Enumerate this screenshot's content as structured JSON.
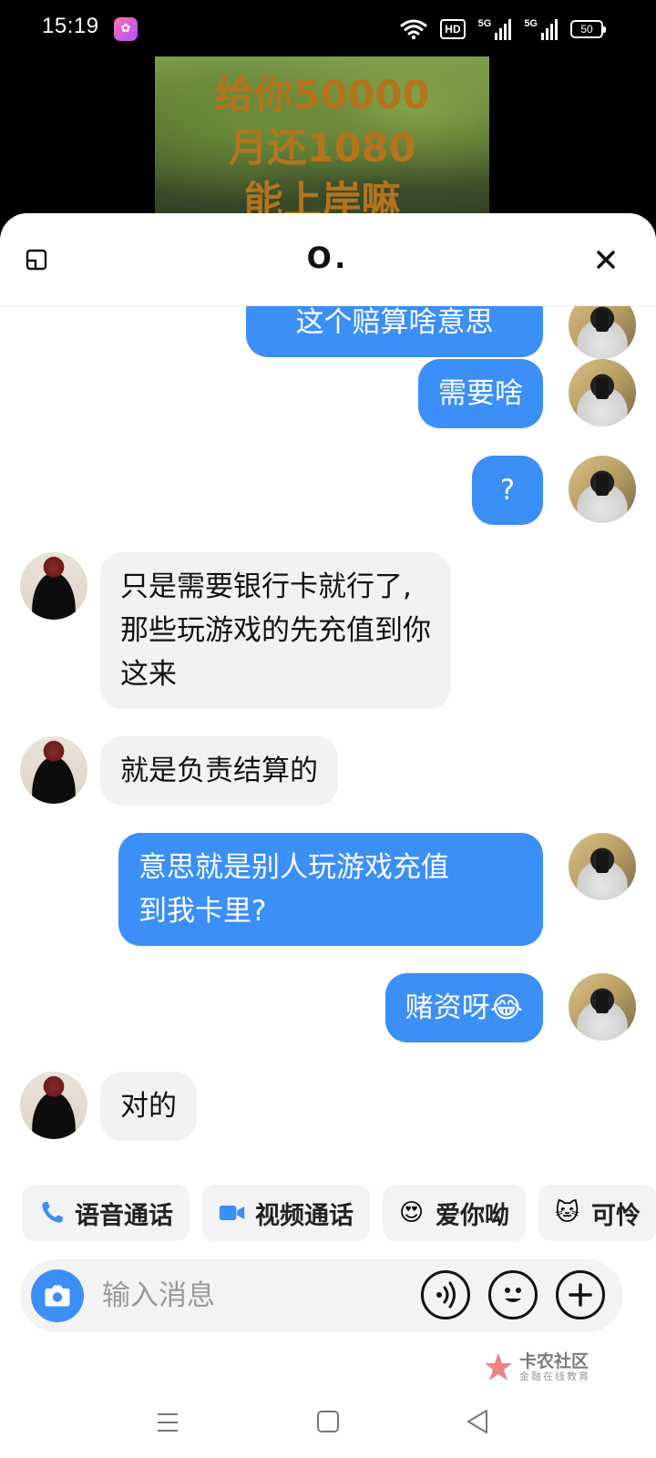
{
  "status_bar": {
    "time": "15:19",
    "hd_label": "HD",
    "signal1_label": "5G",
    "signal2_label": "5G",
    "battery": "50"
  },
  "background_media": {
    "caption_lines": [
      "给你50000",
      "月还1080",
      "能上岸嘛"
    ]
  },
  "chat_header": {
    "title": "O."
  },
  "messages": [
    {
      "sender": "self",
      "text": "这个赔算啥意思"
    },
    {
      "sender": "self",
      "text": "需要啥"
    },
    {
      "sender": "self",
      "text": "?"
    },
    {
      "sender": "other",
      "text": "只是需要银行卡就行了,\n那些玩游戏的先充值到你\n这来"
    },
    {
      "sender": "other",
      "text": "就是负责结算的"
    },
    {
      "sender": "self",
      "text": "意思就是别人玩游戏充值\n到我卡里?"
    },
    {
      "sender": "self",
      "text": "赌资呀😂"
    },
    {
      "sender": "other",
      "text": "对的"
    }
  ],
  "quick_actions": [
    {
      "label": "语音通话",
      "icon": "phone-icon"
    },
    {
      "label": "视频通话",
      "icon": "video-camera-icon"
    },
    {
      "label": "爱你呦",
      "icon": "heart-eyes-emoji-icon",
      "emoji": "😍"
    },
    {
      "label": "可怜",
      "icon": "pleading-cat-emoji-icon",
      "emoji": "🐱"
    }
  ],
  "input_bar": {
    "placeholder": "输入消息"
  },
  "watermark": {
    "title": "卡农社区",
    "subtitle": "金融在线教育"
  },
  "colors": {
    "self_bubble": "#3b8ff7",
    "other_bubble": "#f2f2f2",
    "accent": "#3b8ff7"
  }
}
